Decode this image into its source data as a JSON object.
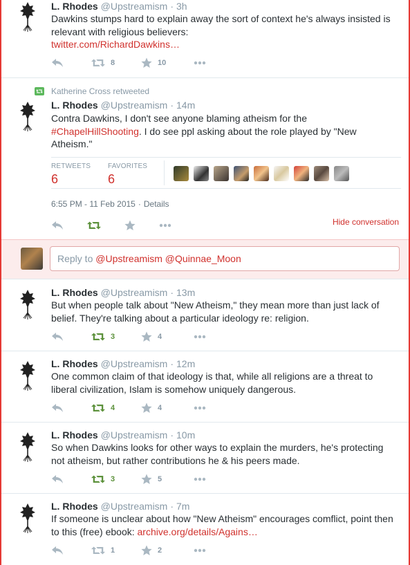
{
  "colors": {
    "accent": "#d0312d",
    "retweet_green": "#5c913b",
    "muted": "#8899a6",
    "border": "#e53935"
  },
  "tweets_top": [
    {
      "name": "L. Rhodes",
      "handle": "@Upstreamism",
      "time": "3h",
      "text": "Dawkins stumps hard to explain away the sort of context he's always insisted is relevant with religious believers:",
      "link": "twitter.com/RichardDawkins…",
      "retweets": "8",
      "favorites": "10"
    }
  ],
  "focused": {
    "retweeted_by": "Katherine Cross retweeted",
    "name": "L. Rhodes",
    "handle": "@Upstreamism",
    "time": "14m",
    "text_before": "Contra Dawkins, I don't see anyone blaming atheism for the ",
    "hashtag": "#ChapelHillShooting",
    "text_after": ". I do see ppl asking about the role played by \"New Atheism.\"",
    "retweets_label": "RETWEETS",
    "retweets_value": "6",
    "favorites_label": "FAVORITES",
    "favorites_value": "6",
    "timestamp": "6:55 PM - 11 Feb 2015",
    "details": "Details",
    "hide_conversation": "Hide conversation"
  },
  "reply": {
    "prefix": "Reply to ",
    "mentions": "@Upstreamism @Quinnae_Moon"
  },
  "replies": [
    {
      "name": "L. Rhodes",
      "handle": "@Upstreamism",
      "time": "13m",
      "text": "But when people talk about \"New Atheism,\" they mean more than just lack of belief. They're talking about a particular ideology re: religion.",
      "retweets": "3",
      "favorites": "4",
      "rt_green": true
    },
    {
      "name": "L. Rhodes",
      "handle": "@Upstreamism",
      "time": "12m",
      "text": "One common claim of that ideology is that, while all religions are a threat to liberal civilization, Islam is somehow uniquely dangerous.",
      "retweets": "4",
      "favorites": "4",
      "rt_green": true
    },
    {
      "name": "L. Rhodes",
      "handle": "@Upstreamism",
      "time": "10m",
      "text": "So when Dawkins looks for other ways to explain the murders, he's protecting not atheism, but rather contributions he & his peers made.",
      "retweets": "3",
      "favorites": "5",
      "rt_green": true
    },
    {
      "name": "L. Rhodes",
      "handle": "@Upstreamism",
      "time": "7m",
      "text": "If someone is unclear about how \"New Atheism\" encourages comflict, point then to this (free) ebook: ",
      "link": "archive.org/details/Agains…",
      "retweets": "1",
      "favorites": "2",
      "rt_green": false
    }
  ]
}
